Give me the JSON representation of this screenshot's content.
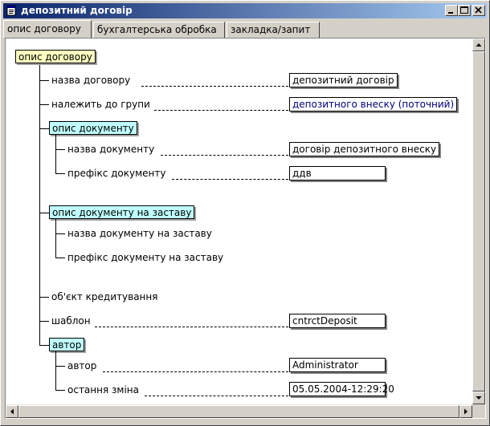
{
  "window": {
    "title": "депозитний договір"
  },
  "tabs": [
    {
      "label": "опис договору",
      "active": true
    },
    {
      "label": "бухгалтерська обробка",
      "active": false
    },
    {
      "label": "закладка/запит",
      "active": false
    }
  ],
  "tree": {
    "root": {
      "label": "опис договору"
    },
    "contract_name": {
      "label": "назва договору",
      "value": "депозитний договір"
    },
    "group": {
      "label": "належить до групи",
      "value": "депозитного внеску (поточний)"
    },
    "doc": {
      "label": "опис документу",
      "name": {
        "label": "назва документу",
        "value": "договір депозитного внеску"
      },
      "prefix": {
        "label": "префікс документу",
        "value": "ддв"
      }
    },
    "pledge": {
      "label": "опис документу на заставу",
      "name": {
        "label": "назва документу на заставу"
      },
      "prefix": {
        "label": "префікс документу на заставу"
      }
    },
    "credit_object": {
      "label": "об'єкт кредитування"
    },
    "template": {
      "label": "шаблон",
      "value": "cntrctDeposit"
    },
    "author_section": {
      "label": "автор",
      "author": {
        "label": "автор",
        "value": "Administrator"
      },
      "last_change": {
        "label": "остання зміна",
        "value": "05.05.2004-12:29:20"
      }
    }
  },
  "icons": {
    "window": "document-icon",
    "minimize": "minimize-icon",
    "maximize": "maximize-icon",
    "close": "close-icon",
    "scroll_up": "arrow-up-icon",
    "scroll_down": "arrow-down-icon",
    "scroll_left": "arrow-left-icon",
    "scroll_right": "arrow-right-icon"
  },
  "colors": {
    "titlebar_start": "#0a246a",
    "titlebar_end": "#a6caf0",
    "root_node": "#ffffc0",
    "section_node": "#c0ffff",
    "link_value": "#000080"
  }
}
